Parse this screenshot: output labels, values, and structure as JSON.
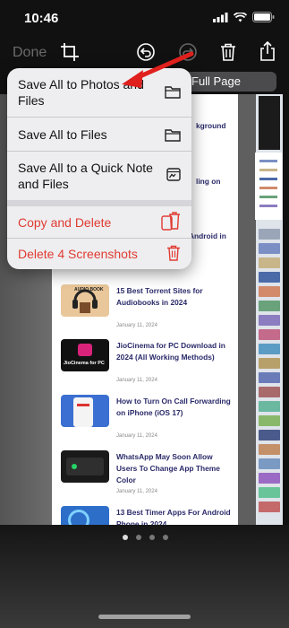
{
  "status": {
    "time": "10:46"
  },
  "toolbar": {
    "done_label": "Done"
  },
  "segment": {
    "label": "Full Page"
  },
  "menu": {
    "items": [
      {
        "label": "Save All to Photos and Files",
        "icon": "folder-icon"
      },
      {
        "label": "Save All to Files",
        "icon": "folder-icon"
      },
      {
        "label": "Save All to a Quick Note and Files",
        "icon": "quick-note-icon"
      },
      {
        "label": "Copy and Delete",
        "icon": "copy-delete-icon"
      },
      {
        "label": "Delete 4 Screenshots",
        "icon": "trash-icon"
      }
    ]
  },
  "preview": {
    "fragments": [
      "kground",
      "ling on",
      "Android in"
    ],
    "articles": [
      {
        "title": "15 Best Torrent Sites for Audiobooks in 2024",
        "date": "January 11, 2024",
        "thumb_text": "AUDIO BOOK"
      },
      {
        "title": "JioCinema for PC Download in 2024 (All Working Methods)",
        "date": "January 11, 2024",
        "thumb_text": "JioCinema for PC"
      },
      {
        "title": "How to Turn On Call Forwarding on iPhone (iOS 17)",
        "date": "January 11, 2024",
        "thumb_text": ""
      },
      {
        "title": "WhatsApp May Soon Allow Users To Change App Theme Color",
        "date": "January 11, 2024",
        "thumb_text": ""
      },
      {
        "title": "13 Best Timer Apps For Android Phone in 2024",
        "date": "",
        "thumb_text": ""
      }
    ]
  },
  "colors": {
    "menu_bg": "#eeeef0",
    "destructive": "#e03b32",
    "accent_arrow": "#e0201d"
  }
}
